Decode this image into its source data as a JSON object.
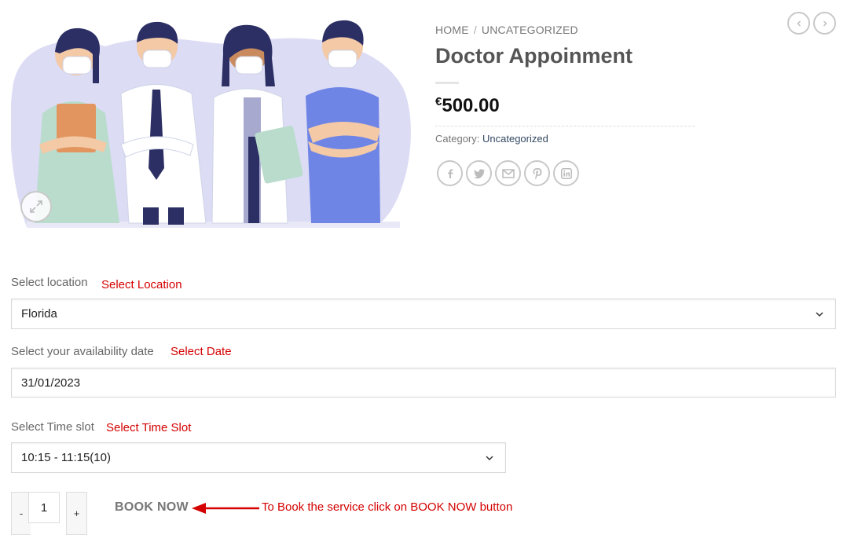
{
  "breadcrumb": {
    "home": "HOME",
    "separator": "/",
    "category": "UNCATEGORIZED"
  },
  "product": {
    "title": "Doctor Appoinment",
    "currency": "€",
    "price": "500.00",
    "category_label": "Category:",
    "category_value": "Uncategorized"
  },
  "share_icons": [
    "facebook-icon",
    "twitter-icon",
    "email-icon",
    "pinterest-icon",
    "linkedin-icon"
  ],
  "form": {
    "location_label": "Select location",
    "location_hint": "Select Location",
    "location_value": "Florida",
    "date_label": "Select your availability date",
    "date_hint": "Select Date",
    "date_value": "31/01/2023",
    "slot_label": "Select Time slot",
    "slot_hint": "Select Time Slot",
    "slot_value": "10:15 - 11:15(10)"
  },
  "cart": {
    "minus": "-",
    "quantity": "1",
    "plus": "+",
    "book_label": "BOOK NOW",
    "book_hint": "To Book the service click on BOOK NOW button"
  },
  "colors": {
    "accent_red": "#d40000",
    "link": "#334862",
    "hero_blob": "#dcdcf5"
  }
}
